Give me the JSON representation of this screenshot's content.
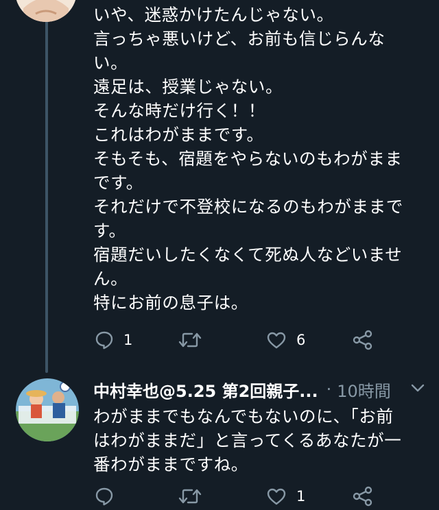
{
  "tweet1": {
    "lines": [
      "いや、迷惑かけたんじゃない。",
      "言っちゃ悪いけど、お前も信じらんな",
      "い。",
      "遠足は、授業じゃない。",
      "そんな時だけ行く！！",
      "これはわがままです。",
      "そもそも、宿題をやらないのもわがまま",
      "です。",
      "それだけで不登校になるのもわがままで",
      "す。",
      "宿題だいしたくなくて死ぬ人などいませ",
      "ん。",
      "特にお前の息子は。"
    ],
    "reply_count": "1",
    "like_count": "6"
  },
  "tweet2": {
    "author": "中村幸也@5.25 第2回親子...",
    "separator": "·",
    "time": "10時間",
    "lines": [
      "わがままでもなんでもないのに、「お前",
      "はわがままだ」と言ってくるあなたが一",
      "番わがままですね。"
    ],
    "like_count": "1"
  },
  "colors": {
    "background": "#141d26",
    "muted": "#8899a6",
    "thread_line": "#3d5466"
  },
  "icons": [
    "reply-icon",
    "retweet-icon",
    "like-icon",
    "share-icon",
    "chevron-down-icon"
  ]
}
